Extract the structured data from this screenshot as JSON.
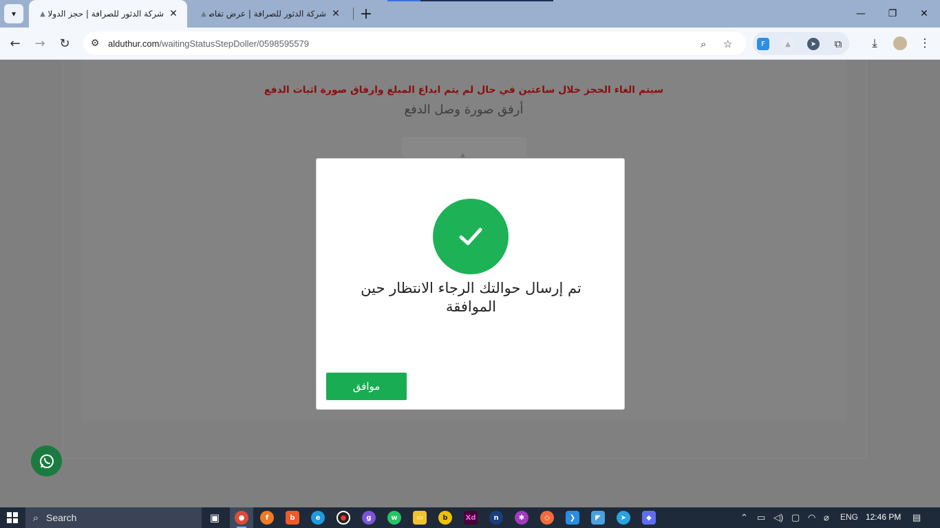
{
  "browser": {
    "tabs": [
      {
        "title": "شركة الدثور للصرافة | حجز الدولار",
        "active": true
      },
      {
        "title": "شركة الدثور للصرافة | عرض تفاصيل",
        "active": false
      }
    ],
    "url_host": "alduthur.com",
    "url_path": "/waitingStatusStepDoller/0598595579"
  },
  "page": {
    "warning": "سيتم الغاء الحجز خلال ساعتين في حال لم يتم ايداع المبلغ وارفاق صورة اثبات الدفع",
    "attach_label": "أرفق صورة وصل الدفع"
  },
  "dialog": {
    "message": "تم إرسال حوالتك الرجاء الانتظار حين الموافقة",
    "ok_label": "موافق",
    "success_color": "#1db256"
  },
  "taskbar": {
    "search_label": "Search",
    "language": "ENG",
    "time": "12:46 PM"
  },
  "icons": [
    "tab-search-icon",
    "close-icon",
    "new-tab-icon",
    "minimize-icon",
    "restore-icon",
    "back-icon",
    "forward-icon",
    "reload-icon",
    "site-info-icon",
    "zoom-icon",
    "bookmark-star-icon",
    "extensions-icon",
    "download-icon",
    "profile-avatar",
    "menu-icon",
    "checkmark-icon",
    "whatsapp-icon",
    "windows-start-icon"
  ]
}
